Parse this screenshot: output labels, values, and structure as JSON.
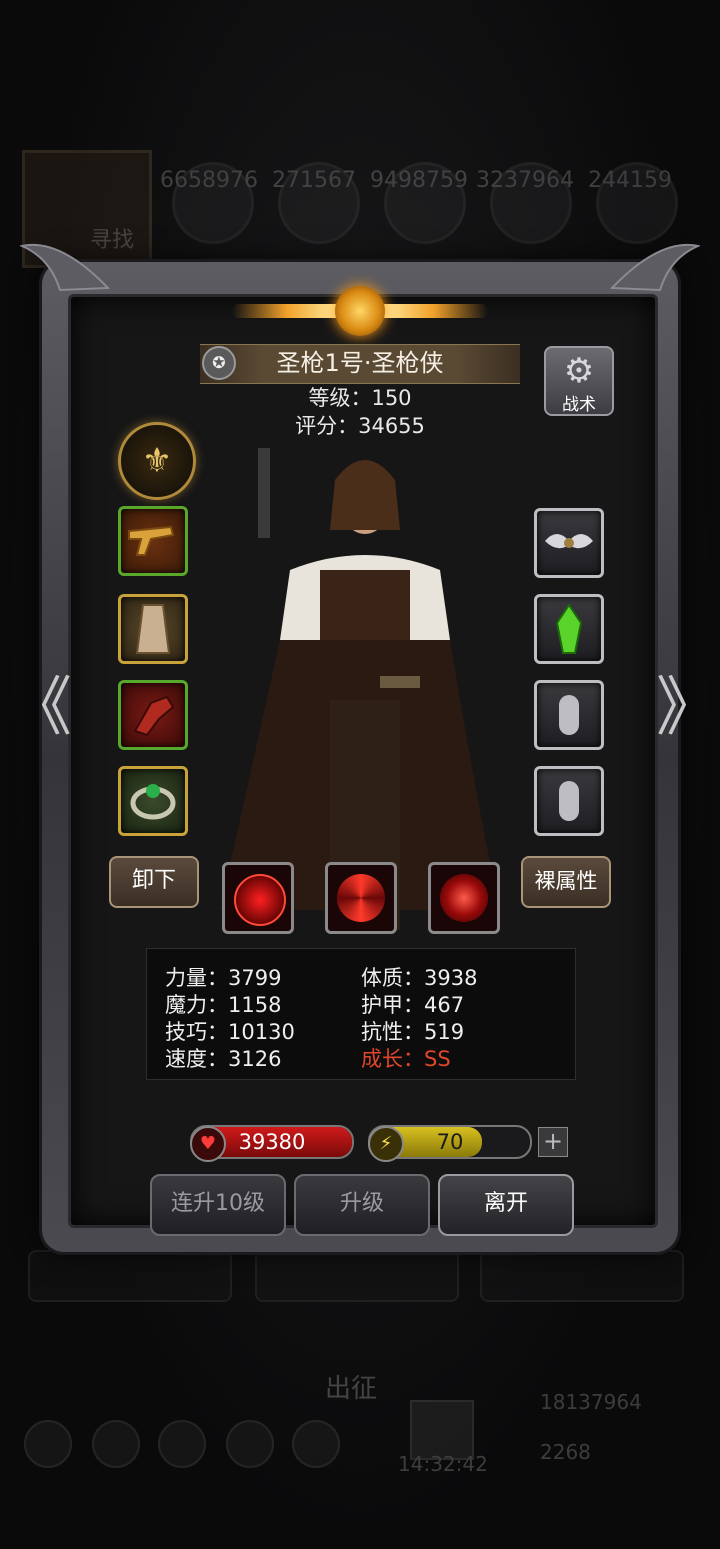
{
  "background": {
    "resources": [
      "6658976",
      "271567",
      "9498759",
      "3237964",
      "244159"
    ],
    "search_label": "寻找",
    "go_label": "出征",
    "gold": "18137964",
    "gems": "2268",
    "time": "14:32:42"
  },
  "hero": {
    "name": "圣枪1号·圣枪侠",
    "level_text": "等级：150",
    "score_text": "评分：34655",
    "tactic_label": "战术",
    "tactic_icon": "gear-icon",
    "crest_icon": "class-crest-icon"
  },
  "equipment": {
    "left": [
      "golden-pistol-icon",
      "robe-armor-icon",
      "gauntlet-icon",
      "emerald-ring-icon"
    ],
    "right": [
      "winged-amulet-icon",
      "green-crystal-icon",
      "empty-slot-icon",
      "empty-slot-icon"
    ]
  },
  "actions": {
    "unequip_label": "卸下",
    "base_attr_label": "裸属性",
    "skills": [
      "target-skill-icon",
      "vortex-skill-icon",
      "blood-orb-skill-icon"
    ]
  },
  "stats": {
    "strength": "力量：3799",
    "magic": "魔力：1158",
    "skill": "技巧：10130",
    "speed": "速度：3126",
    "constitution": "体质：3938",
    "armor": "护甲：467",
    "resistance": "抗性：519",
    "growth": "成长：SS",
    "growth_color": "#e0462a"
  },
  "bars": {
    "hp_value": "39380",
    "hp_fill": 1.0,
    "hp_color": "#d01a1a",
    "energy_value": "70",
    "energy_fill": 0.7,
    "energy_color": "#d8c020",
    "plus_label": "+"
  },
  "buttons": {
    "multi_upgrade": "连升10级",
    "upgrade": "升级",
    "leave": "离开"
  },
  "nav": {
    "prev": "《",
    "next": "》"
  }
}
